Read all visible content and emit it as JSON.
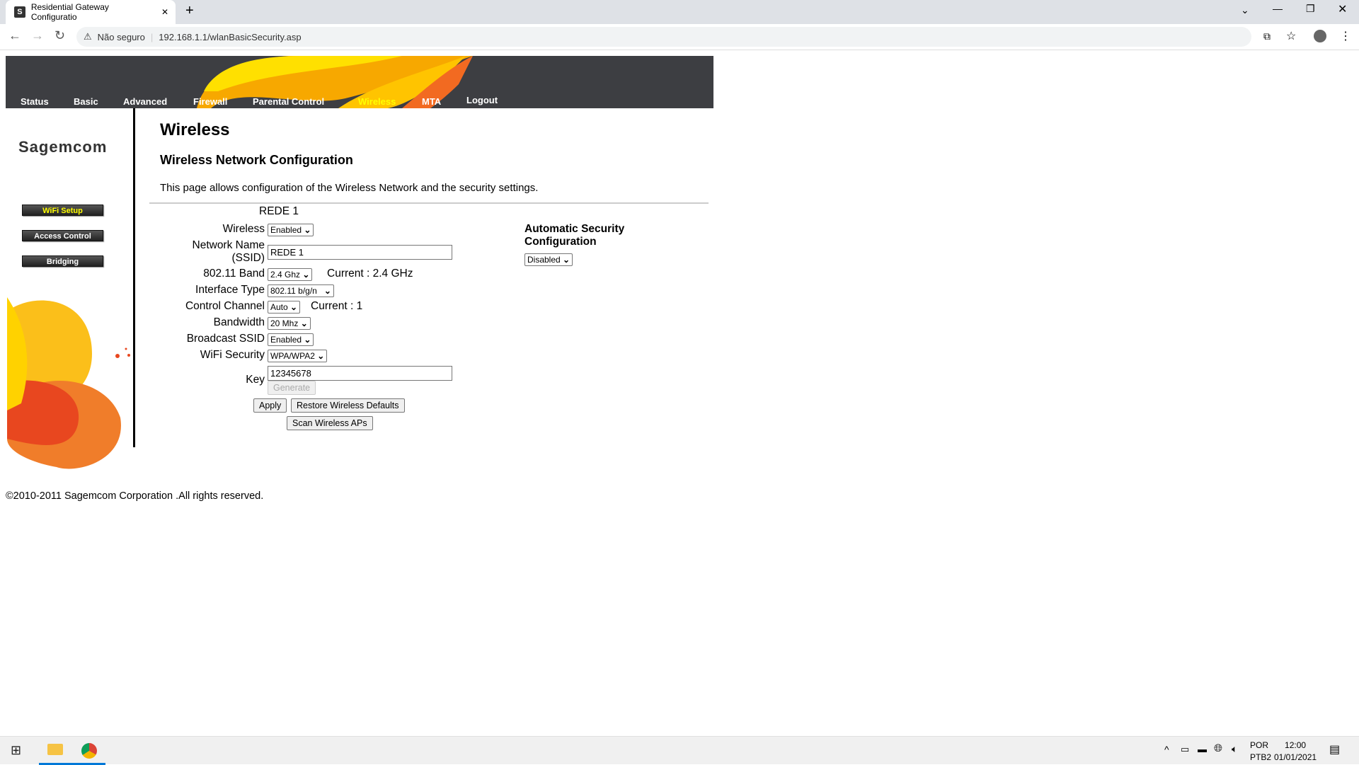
{
  "browser": {
    "tab_title": "Residential Gateway Configuratio",
    "tab_favicon": "S",
    "security_label": "Não seguro",
    "url": "192.168.1.1/wlanBasicSecurity.asp"
  },
  "nav": {
    "items": [
      "Status",
      "Basic",
      "Advanced",
      "Firewall",
      "Parental Control",
      "Wireless",
      "MTA",
      "Logout"
    ],
    "active": "Wireless",
    "active_color": "#ffff00"
  },
  "sidebar": {
    "logo": "Sagemcom",
    "items": [
      {
        "label": "WiFi Setup",
        "active": true
      },
      {
        "label": "Access Control"
      },
      {
        "label": "Bridging"
      }
    ]
  },
  "main": {
    "title": "Wireless",
    "subtitle": "Wireless Network Configuration",
    "description": "This page allows configuration of the Wireless Network and the security settings.",
    "network_heading": "REDE 1",
    "fields": {
      "wireless": {
        "label": "Wireless",
        "value": "Enabled"
      },
      "ssid": {
        "label_line1": "Network Name",
        "label_line2": "(SSID)",
        "value": "REDE 1"
      },
      "band": {
        "label": "802.11 Band",
        "value": "2.4 Ghz",
        "current": "Current :  2.4 GHz"
      },
      "interface": {
        "label": "Interface Type",
        "value": "802.11 b/g/n"
      },
      "channel": {
        "label": "Control Channel",
        "value": "Auto",
        "current": "Current : 1"
      },
      "bandwidth": {
        "label": "Bandwidth",
        "value": "20 Mhz"
      },
      "broadcast": {
        "label": "Broadcast SSID",
        "value": "Enabled"
      },
      "security": {
        "label": "WiFi Security",
        "value": "WPA/WPA2"
      },
      "key": {
        "label": "Key",
        "value": "12345678"
      }
    },
    "buttons": {
      "generate": "Generate",
      "apply": "Apply",
      "restore": "Restore Wireless Defaults",
      "scan": "Scan Wireless APs"
    },
    "auto_security": {
      "label_line1": "Automatic Security",
      "label_line2": "Configuration",
      "value": "Disabled"
    }
  },
  "footer": "©2010-2011 Sagemcom Corporation .All rights reserved.",
  "taskbar": {
    "lang1": "POR",
    "lang2": "PTB2",
    "time": "12:00",
    "date": "01/01/2021"
  }
}
